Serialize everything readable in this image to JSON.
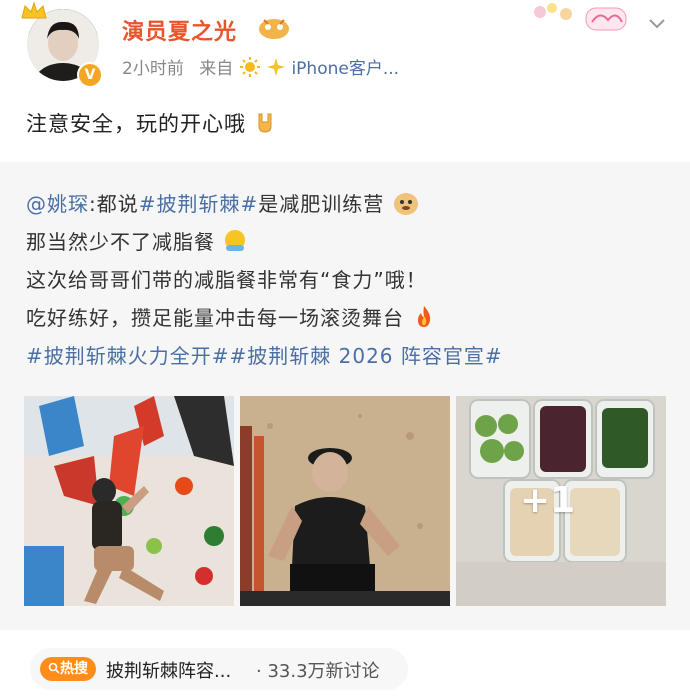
{
  "user": {
    "name": "演员夏之光",
    "time": "2小时前",
    "from_prefix": "来自",
    "source": "iPhone客户...",
    "verified_mark": "V"
  },
  "post": {
    "text": "注意安全，玩的开心哦"
  },
  "repost": {
    "lines": [
      {
        "mention": "@姚琛",
        "pre": ":都说",
        "tag": "#披荆斩棘#",
        "post": "是减肥训练营"
      },
      {
        "text": "那当然少不了减脂餐"
      },
      {
        "text": "这次给哥哥们带的减脂餐非常有“食力”哦！"
      },
      {
        "text": "吃好练好，攒足能量冲击每一场滚烫舞台"
      },
      {
        "tags": "#披荆斩棘火力全开##披荆斩棘 2026 阵容官宣#"
      }
    ],
    "more_photos": "+1"
  },
  "hot": {
    "badge": "热搜",
    "text": "披荆斩棘阵容...",
    "count": "· 33.3万新讨论"
  },
  "colors": {
    "username": "#e8552c",
    "link": "#4a6fa5",
    "hot_badge": "#ff8d1a"
  }
}
